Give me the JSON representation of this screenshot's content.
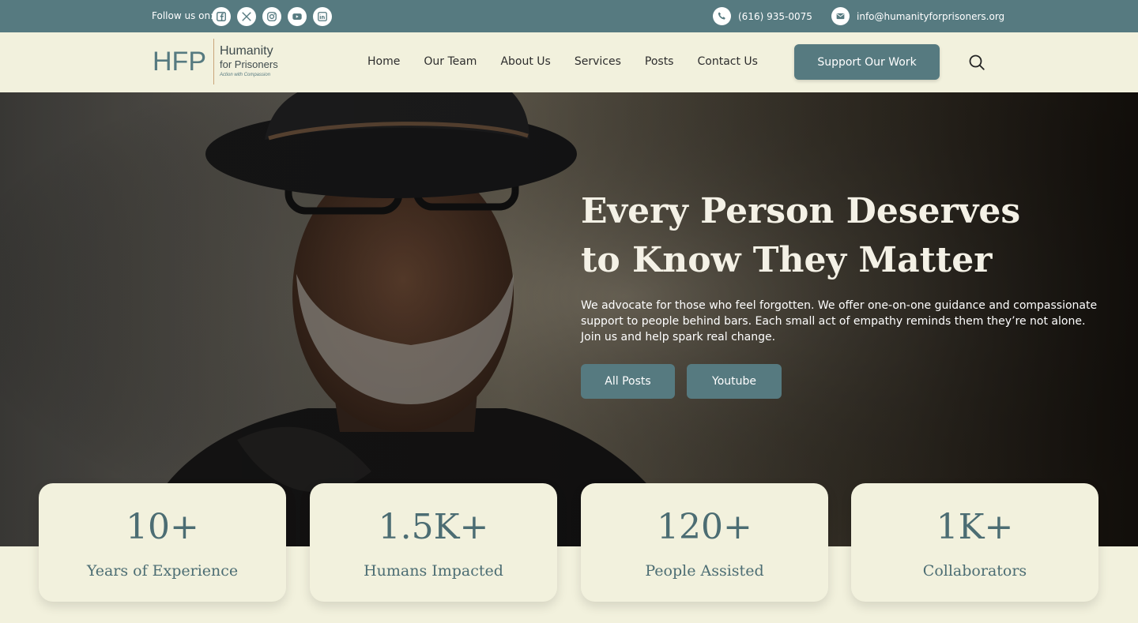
{
  "topbar": {
    "follow_label": "Follow us on:",
    "socials": [
      {
        "icon": "facebook-icon"
      },
      {
        "icon": "x-icon"
      },
      {
        "icon": "instagram-icon"
      },
      {
        "icon": "youtube-icon"
      },
      {
        "icon": "linkedin-icon"
      }
    ],
    "phone": "(616) 935-0075",
    "email": "info@humanityforprisoners.org"
  },
  "header": {
    "logo_mark": "HFP",
    "logo_line1": "Humanity",
    "logo_line2": "for Prisoners",
    "logo_tagline": "Action with Compassion",
    "nav": [
      "Home",
      "Our Team",
      "About Us",
      "Services",
      "Posts",
      "Contact Us"
    ],
    "cta": "Support Our Work"
  },
  "hero": {
    "title": "Every Person Deserves to Know They Matter",
    "subtitle": "We advocate for those who feel forgotten. We offer one-on-one guidance and compassionate support to people behind bars. Each small act of empathy reminds them they’re not alone. Join us and help spark real change.",
    "buttons": [
      "All Posts",
      "Youtube"
    ]
  },
  "stats": [
    {
      "value": "10+",
      "label": "Years of Experience"
    },
    {
      "value": "1.5K+",
      "label": "Humans Impacted"
    },
    {
      "value": "120+",
      "label": "People Assisted"
    },
    {
      "value": "1K+",
      "label": "Collaborators"
    }
  ],
  "colors": {
    "accent": "#567a80",
    "background": "#f2f1dd",
    "stat_text": "#4c6d73"
  }
}
